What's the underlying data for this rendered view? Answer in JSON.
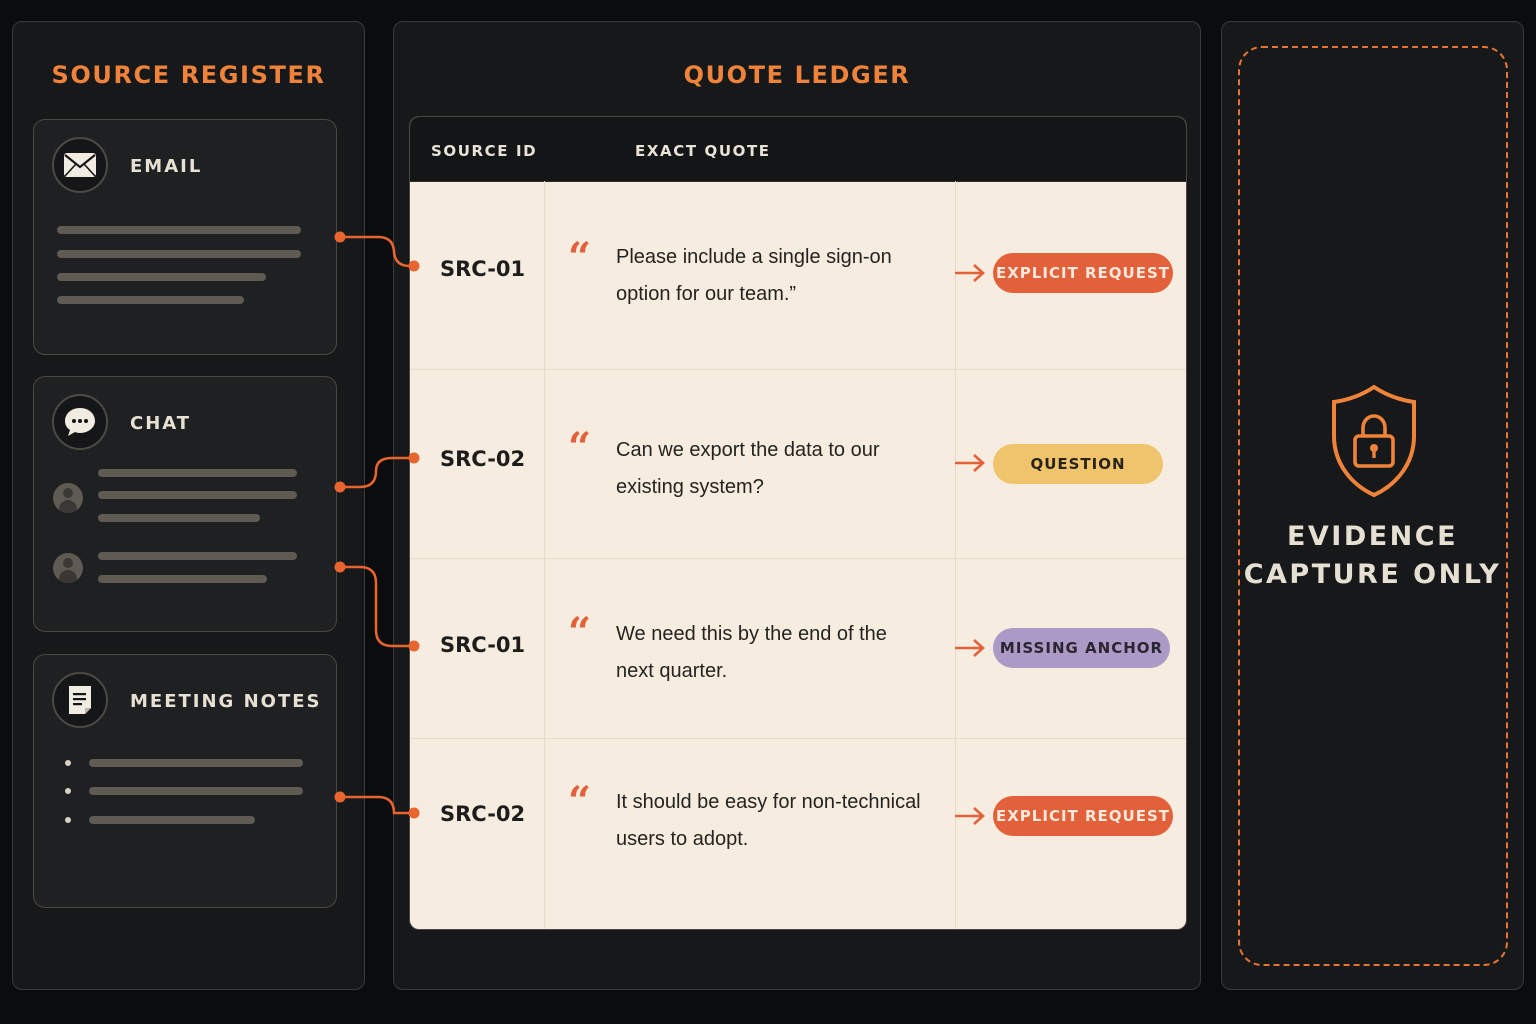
{
  "source_register": {
    "title": "SOURCE REGISTER",
    "cards": [
      {
        "label": "EMAIL",
        "icon": "envelope-icon"
      },
      {
        "label": "CHAT",
        "icon": "chat-bubble-icon"
      },
      {
        "label": "MEETING NOTES",
        "icon": "notes-icon"
      }
    ]
  },
  "quote_ledger": {
    "title": "QUOTE LEDGER",
    "columns": [
      "SOURCE ID",
      "EXACT QUOTE"
    ],
    "rows": [
      {
        "source_id": "SRC-01",
        "quote_mark": "“",
        "quote": "Please include a single sign-on option for our team.”",
        "tag": "EXPLICIT REQUEST",
        "tag_color": "#e2613a"
      },
      {
        "source_id": "SRC-02",
        "quote_mark": "“",
        "quote": "Can we export the data to our existing system?",
        "tag": "QUESTION",
        "tag_color": "#f0c46c"
      },
      {
        "source_id": "SRC-01",
        "quote_mark": "“",
        "quote": "We need this by the end of the next quarter.",
        "tag": "MISSING ANCHOR",
        "tag_color": "#ab9ac6"
      },
      {
        "source_id": "SRC-02",
        "quote_mark": "“",
        "quote": "It should be easy for non-technical users to adopt.",
        "tag": "EXPLICIT REQUEST",
        "tag_color": "#e2613a"
      }
    ]
  },
  "evidence_panel": {
    "line1": "EVIDENCE",
    "line2": "CAPTURE ONLY",
    "icon": "shield-lock-icon"
  },
  "colors": {
    "accent": "#f0833a",
    "background": "#0b0c0d",
    "panel": "#17181a",
    "table_body": "#f6ede0"
  }
}
